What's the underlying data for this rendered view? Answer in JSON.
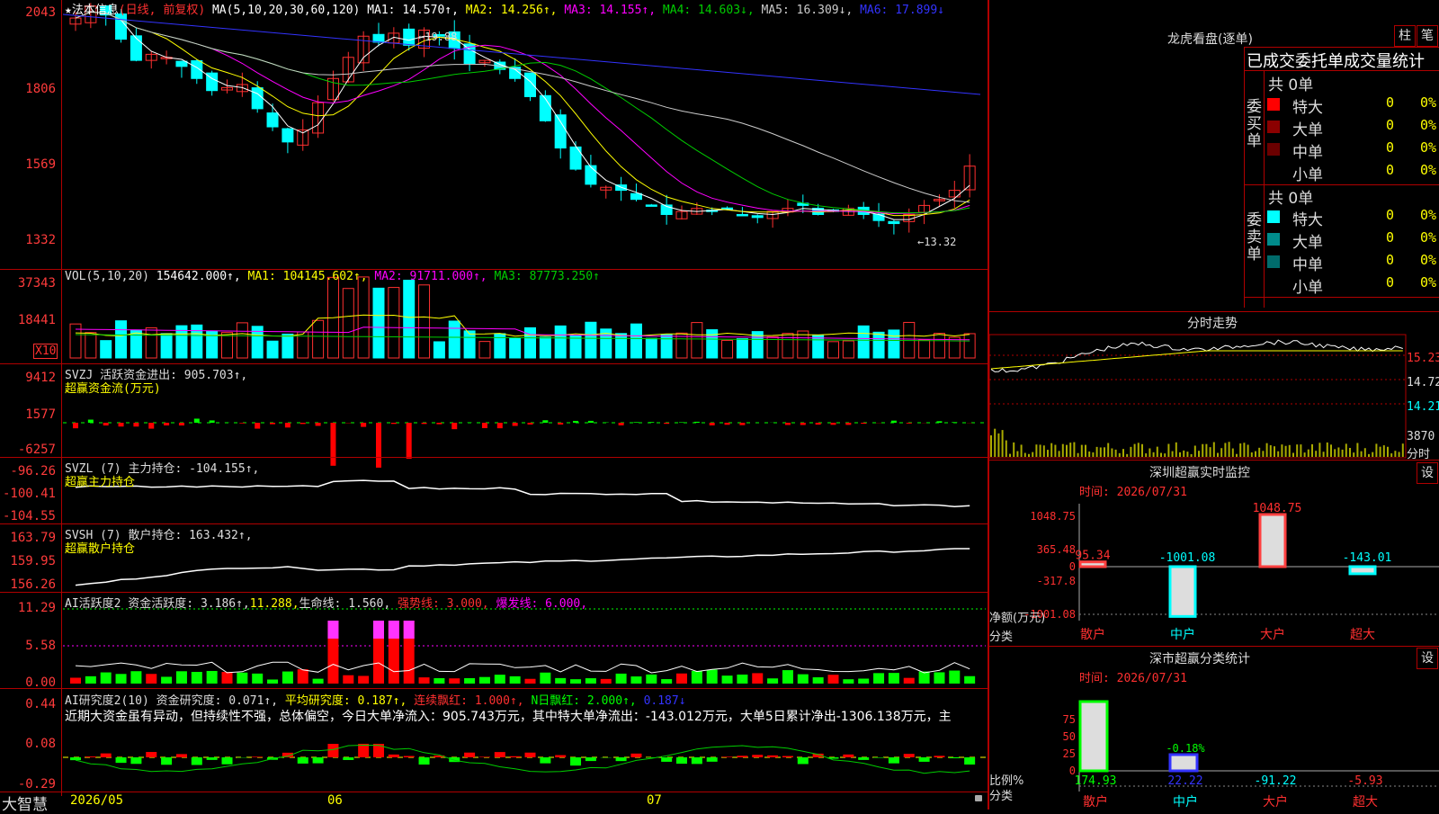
{
  "kline": {
    "title_star": "★",
    "stock_name": "法本信息",
    "period": "(日线, 前复权)",
    "ma_params": "MA(5,10,20,30,60,120)",
    "ma1": "MA1: 14.570↑,",
    "ma2": "MA2: 14.256↑,",
    "ma3": "MA3: 14.155↑,",
    "ma4": "MA4: 14.603↓,",
    "ma5": "MA5: 16.309↓,",
    "ma6": "MA6: 17.899↓",
    "ticks": [
      "2043",
      "1806",
      "1569",
      "1332"
    ],
    "high_label": "←19.88",
    "low_label": "←13.32",
    "colors": {
      "up": "#ff3030",
      "down": "#00ffff",
      "ma1": "#ffffff",
      "ma2": "#ffff00",
      "ma3": "#ff00ff",
      "ma4": "#00cc00",
      "ma5": "#cccccc",
      "ma6": "#3333ff"
    }
  },
  "vol": {
    "header": "VOL(5,10,20)",
    "value": "154642.000↑,",
    "ma1": "MA1: 104145.602↑,",
    "ma2": "MA2: 91711.000↑,",
    "ma3": "MA3: 87773.250↑",
    "ticks": [
      "37343",
      "18441"
    ],
    "unit": "X10"
  },
  "svzj": {
    "header": "SVZJ  活跃资金进出: 905.703↑,",
    "sub": "超赢资金流(万元)",
    "ticks": [
      "9412",
      "1577",
      "-6257"
    ]
  },
  "svzl": {
    "header": "SVZL (7) 主力持仓: -104.155↑,",
    "sub": "超赢主力持仓",
    "ticks": [
      "-96.26",
      "-100.41",
      "-104.55"
    ]
  },
  "svsh": {
    "header": "SVSH (7) 散户持仓: 163.432↑,",
    "sub": "超赢散户持仓",
    "ticks": [
      "163.79",
      "159.95",
      "156.26"
    ]
  },
  "ai1": {
    "h1": "AI活跃度2 资金活跃度: 3.186↑,",
    "h2": "11.288,",
    "h3": "生命线: 1.560,",
    "h4": "强势线: 3.000,",
    "h5": "爆发线: 6.000,",
    "ticks": [
      "11.29",
      "5.58",
      "0.00"
    ]
  },
  "ai2": {
    "h1": "AI研究度2(10) 资金研究度: 0.071↑,",
    "h2": "平均研究度: 0.187↑,",
    "h3": "连续飘红: 1.000↑,",
    "h4": "N日飘红: 2.000↑,",
    "h5": "0.187↓",
    "comment": "近期大资金虽有异动，但持续性不强，总体偏空，今日大单净流入：905.743万元，其中特大单净流出：-143.012万元，大单5日累计净出-1306.138万元，主",
    "ticks": [
      "0.44",
      "0.08",
      "-0.29"
    ]
  },
  "xaxis": {
    "brand": "大智慧",
    "labels": [
      "2026/05",
      "06",
      "07"
    ]
  },
  "right": {
    "lhb_title": "龙虎看盘(逐单)",
    "btn_zhu": "柱",
    "btn_bi": "笔",
    "ob_title": "已成交委托单成交量统计",
    "buy_side": "委买单",
    "sell_side": "委卖单",
    "buy_total": "共 0单",
    "sell_total": "共 0单",
    "buy_rows": [
      {
        "name": "特大",
        "v": "0",
        "p": "0%"
      },
      {
        "name": "大单",
        "v": "0",
        "p": "0%"
      },
      {
        "name": "中单",
        "v": "0",
        "p": "0%"
      },
      {
        "name": "小单",
        "v": "0",
        "p": "0%"
      }
    ],
    "sell_rows": [
      {
        "name": "特大",
        "v": "0",
        "p": "0%"
      },
      {
        "name": "大单",
        "v": "0",
        "p": "0%"
      },
      {
        "name": "中单",
        "v": "0",
        "p": "0%"
      },
      {
        "name": "小单",
        "v": "0",
        "p": "0%"
      }
    ],
    "fs_title": "分时走势",
    "fs_ticks": [
      "15.23",
      "14.72",
      "14.21"
    ],
    "fs_vol": "3870",
    "fs_unit": "分时",
    "mon_title": "深圳超赢实时监控",
    "mon_btn": "设",
    "mon_time": "时间: 2026/07/31",
    "mon_ticks": [
      "1048.75",
      "365.48",
      "0",
      "-317.8",
      "-1001.08"
    ],
    "mon_ylabel": "净额(万元)",
    "mon_xlabel": "分类",
    "mon_values": [
      {
        "cat": "散户",
        "label": "95.34",
        "value": 95.34
      },
      {
        "cat": "中户",
        "label": "-1001.08",
        "value": -1001.08
      },
      {
        "cat": "大户",
        "label": "1048.75",
        "value": 1048.75
      },
      {
        "cat": "超大",
        "label": "-143.01",
        "value": -143.01
      }
    ],
    "cls_title": "深市超赢分类统计",
    "cls_btn": "设",
    "cls_time": "时间: 2026/07/31",
    "cls_ticks": [
      "75",
      "50",
      "25",
      "0"
    ],
    "cls_ylabel": "比例%",
    "cls_xlabel": "分类",
    "cls_values": [
      {
        "cat": "散户",
        "label": "174.93",
        "value": 174.93
      },
      {
        "cat": "中户",
        "label": "22.22",
        "value": 22.22,
        "pct": "-0.18%"
      },
      {
        "cat": "大户",
        "label": "-91.22",
        "value": -91.22
      },
      {
        "cat": "超大",
        "label": "-5.93",
        "value": -5.93
      }
    ]
  }
}
